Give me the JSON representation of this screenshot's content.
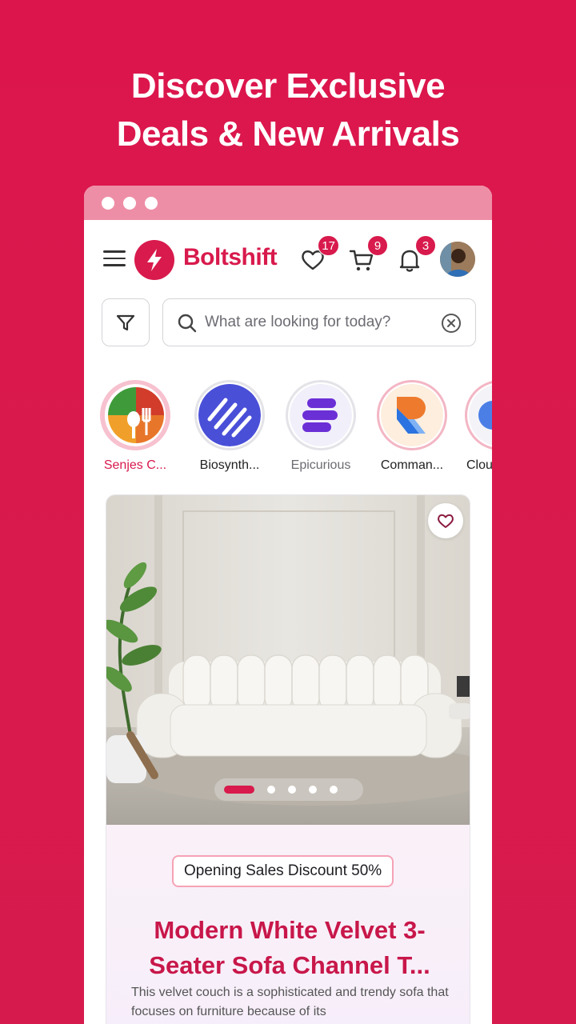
{
  "hero": {
    "line1": "Discover Exclusive",
    "line2": "Deals & New Arrivals"
  },
  "colors": {
    "brand": "#d81a4c",
    "titlebar": "#ee8ea6"
  },
  "header": {
    "menu_icon": "hamburger-menu-icon",
    "logo_icon": "bolt-icon",
    "brand_name": "Boltshift",
    "wishlist_count": "17",
    "cart_count": "9",
    "notifications_count": "3"
  },
  "search": {
    "placeholder": "What are looking for today?",
    "value": ""
  },
  "stories": [
    {
      "label": "Senjes C...",
      "active": true
    },
    {
      "label": "Biosynth...",
      "active": false
    },
    {
      "label": "Epicurious",
      "active": false
    },
    {
      "label": "Comman...",
      "active": false
    },
    {
      "label": "Clou",
      "active": false
    }
  ],
  "product": {
    "promo": "Opening Sales Discount 50%",
    "title": "Modern White Velvet 3-Seater Sofa Channel T...",
    "description": "This velvet couch is a sophisticated and trendy sofa that focuses on furniture because of its",
    "carousel": {
      "total": 5,
      "current": 1
    }
  }
}
